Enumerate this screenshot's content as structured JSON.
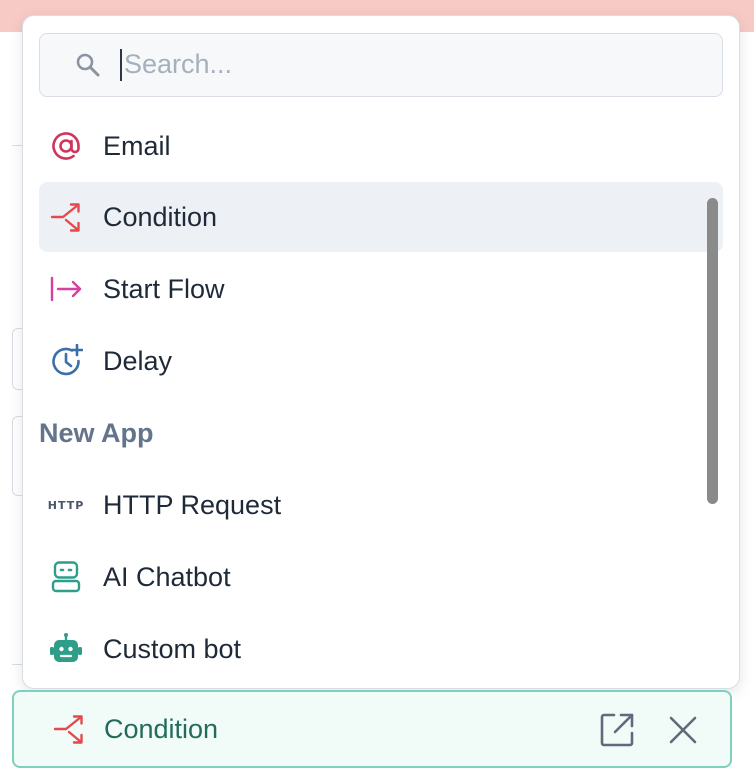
{
  "search": {
    "placeholder": "Search...",
    "value": ""
  },
  "menu": {
    "items": [
      {
        "label": "Email",
        "icon": "at-sign-icon"
      },
      {
        "label": "Condition",
        "icon": "condition-icon"
      },
      {
        "label": "Start Flow",
        "icon": "start-flow-icon"
      },
      {
        "label": "Delay",
        "icon": "delay-clock-icon"
      }
    ],
    "group": {
      "label": "New App",
      "items": [
        {
          "label": "HTTP Request",
          "icon_text": "HTTP"
        },
        {
          "label": "AI Chatbot",
          "icon": "ai-chatbot-icon"
        },
        {
          "label": "Custom bot",
          "icon": "custom-bot-icon"
        }
      ]
    }
  },
  "selected": {
    "label": "Condition",
    "icon": "condition-icon"
  },
  "colors": {
    "banner": "#f7cac6",
    "highlight": "#edf0f5",
    "email_icon": "#d1345b",
    "condition_icon": "#e5484d",
    "start_flow_icon": "#d6409f",
    "delay_icon": "#3a6fa8",
    "bot_icon": "#2f9e88",
    "selected_border": "#7ed1bd",
    "selected_text": "#236b5b"
  }
}
